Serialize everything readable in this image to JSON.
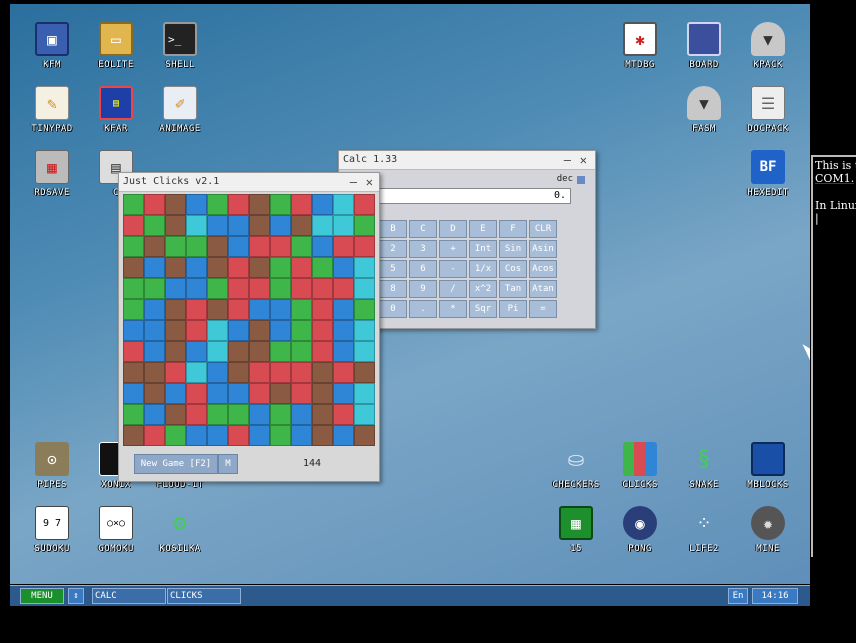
{
  "desktop_icons": [
    {
      "label": "KFM",
      "icon": "floppy-icon"
    },
    {
      "label": "EOLITE",
      "icon": "folder-icon"
    },
    {
      "label": "SHELL",
      "icon": "terminal-icon"
    },
    {
      "label": "MTDBG",
      "icon": "debugger-icon"
    },
    {
      "label": "BOARD",
      "icon": "board-icon"
    },
    {
      "label": "KPACK",
      "icon": "kpack-icon"
    },
    {
      "label": "TINYPAD",
      "icon": "notepad-icon"
    },
    {
      "label": "KFAR",
      "icon": "kfar-icon"
    },
    {
      "label": "ANIMAGE",
      "icon": "paint-icon"
    },
    {
      "label": "FASM",
      "icon": "fasm-icon"
    },
    {
      "label": "DOCPACK",
      "icon": "docpack-icon"
    },
    {
      "label": "RDSAVE",
      "icon": "rdsave-icon"
    },
    {
      "label": "C",
      "icon": "calc-app-icon"
    },
    {
      "label": "HEXEDIT",
      "icon": "hexedit-icon"
    },
    {
      "label": "PIPES",
      "icon": "pipes-icon"
    },
    {
      "label": "XONIX",
      "icon": "xonix-icon"
    },
    {
      "label": "FLOOD-IT",
      "icon": "flood-it-icon"
    },
    {
      "label": "CHECKERS",
      "icon": "checkers-icon"
    },
    {
      "label": "CLICKS",
      "icon": "clicks-icon"
    },
    {
      "label": "SNAKE",
      "icon": "snake-icon"
    },
    {
      "label": "MBLOCKS",
      "icon": "mblocks-icon"
    },
    {
      "label": "SUDOKU",
      "icon": "sudoku-icon"
    },
    {
      "label": "GOMOKU",
      "icon": "gomoku-icon"
    },
    {
      "label": "KOSILKA",
      "icon": "lawnmower-icon"
    },
    {
      "label": "15",
      "icon": "fifteen-icon"
    },
    {
      "label": "PONG",
      "icon": "pong-icon"
    },
    {
      "label": "LIFE2",
      "icon": "life-icon"
    },
    {
      "label": "MINE",
      "icon": "mine-icon"
    }
  ],
  "calc": {
    "title": "Calc 1.33",
    "mode": "dec",
    "display": "0.",
    "keys": [
      [
        "B",
        "C",
        "D",
        "E",
        "F",
        "CLR"
      ],
      [
        "2",
        "3",
        "+",
        "Int",
        "Sin",
        "Asin"
      ],
      [
        "5",
        "6",
        "-",
        "1/x",
        "Cos",
        "Acos"
      ],
      [
        "8",
        "9",
        "/",
        "x^2",
        "Tan",
        "Atan"
      ],
      [
        "0",
        ".",
        "*",
        "Sqr",
        "Pi",
        "="
      ]
    ],
    "colors": {
      "key": "#a8bed8",
      "body": "#d3d5da"
    }
  },
  "clicks": {
    "title": "Just Clicks v2.1",
    "new_game": "New Game [F2]",
    "m_button": "M",
    "score": "144",
    "grid": [
      [
        0,
        1,
        2,
        3,
        0,
        1,
        2,
        0,
        1,
        3,
        4,
        1
      ],
      [
        1,
        0,
        2,
        4,
        3,
        3,
        2,
        3,
        2,
        4,
        4,
        0
      ],
      [
        0,
        2,
        0,
        0,
        2,
        3,
        1,
        1,
        0,
        3,
        1,
        1
      ],
      [
        2,
        3,
        2,
        3,
        2,
        1,
        2,
        0,
        1,
        0,
        3,
        4
      ],
      [
        0,
        0,
        3,
        3,
        0,
        1,
        1,
        0,
        1,
        1,
        1,
        4
      ],
      [
        0,
        3,
        2,
        1,
        2,
        1,
        3,
        3,
        0,
        1,
        3,
        0
      ],
      [
        3,
        3,
        2,
        1,
        4,
        3,
        2,
        3,
        0,
        1,
        3,
        4
      ],
      [
        1,
        3,
        2,
        3,
        4,
        2,
        2,
        0,
        0,
        1,
        3,
        4
      ],
      [
        2,
        2,
        1,
        4,
        3,
        2,
        1,
        1,
        1,
        2,
        1,
        2
      ],
      [
        3,
        2,
        3,
        1,
        3,
        3,
        1,
        2,
        1,
        2,
        3,
        4
      ],
      [
        0,
        3,
        2,
        1,
        0,
        0,
        3,
        0,
        3,
        2,
        1,
        4
      ],
      [
        2,
        1,
        0,
        3,
        3,
        1,
        3,
        0,
        3,
        2,
        3,
        2
      ]
    ]
  },
  "taskbar": {
    "menu": "MENU",
    "arrows": "↕",
    "tasks": [
      "CALC",
      "CLICKS"
    ],
    "lang": "En",
    "clock": "14:16"
  },
  "side_panel": {
    "line1": "This is t",
    "line2": "COM1.",
    "line3": "In Linux",
    "line4": "|"
  }
}
